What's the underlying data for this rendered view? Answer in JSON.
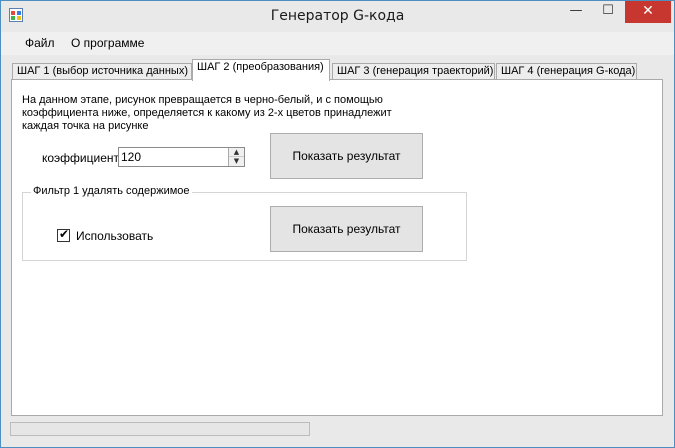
{
  "window": {
    "title": "Генератор G-кода",
    "min_label": "—",
    "max_label": "☐",
    "close_label": "✕"
  },
  "menu": [
    "Файл",
    "О программе"
  ],
  "tabs": [
    {
      "label": "ШАГ 1 (выбор источника данных)",
      "active": false
    },
    {
      "label": "ШАГ 2 (преобразования)",
      "active": true
    },
    {
      "label": "ШАГ 3 (генерация траекторий)",
      "active": false
    },
    {
      "label": "ШАГ 4 (генерация G-кода)",
      "active": false
    }
  ],
  "step2": {
    "description_line1": "На данном этапе, рисунок превращается в черно-белый, и с помощью",
    "description_line2": "коэффициента ниже, определяется к какому из 2-х цветов принадлежит",
    "description_line3": "каждая точка на рисунке",
    "coef_label": "коэффициент",
    "coef_value": "120",
    "show_result_label": "Показать результат",
    "filter": {
      "title": "Фильтр 1 удалять содержимое",
      "use_label": "Использовать",
      "use_checked": true,
      "show_result_label": "Показать результат"
    }
  },
  "status": {
    "progress": 0
  },
  "icons": {
    "app": "app-window-icon",
    "spin_up": "spin-up-icon",
    "spin_down": "spin-down-icon",
    "check": "checkmark-icon"
  }
}
